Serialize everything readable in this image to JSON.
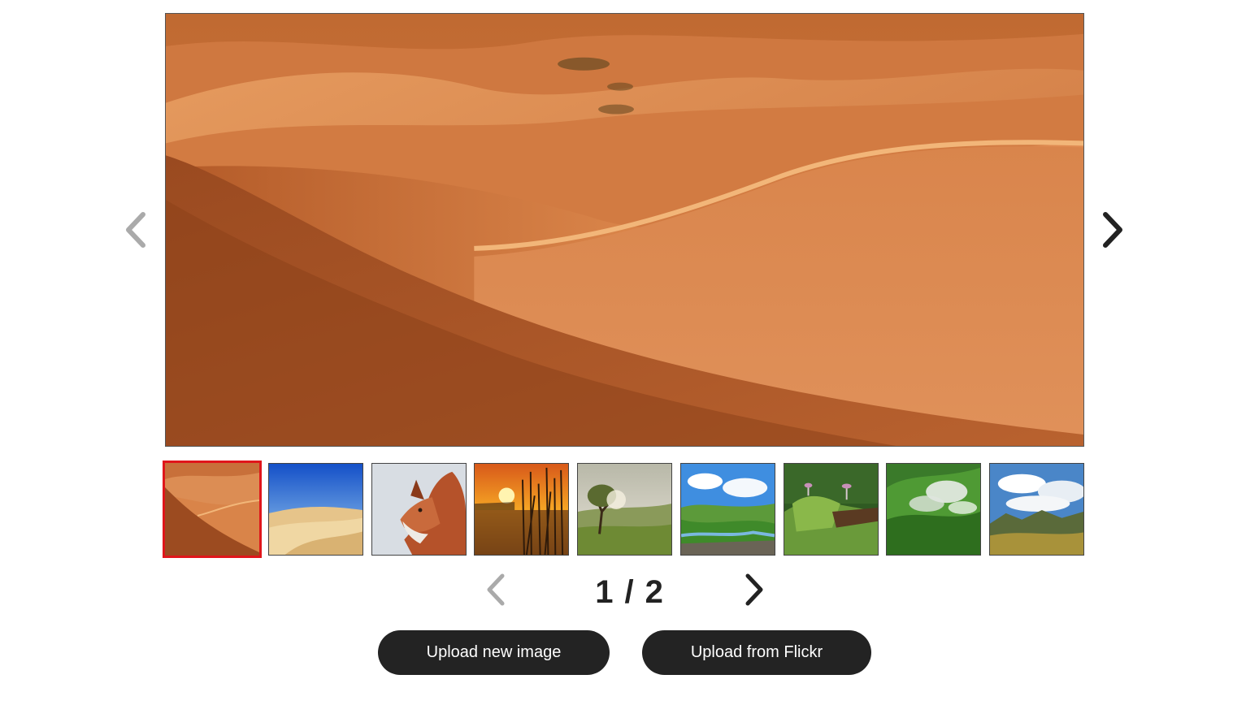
{
  "gallery": {
    "main_image": {
      "icon": "desert-dunes-image"
    },
    "prev_arrow": {
      "icon": "chevron-left-icon",
      "color": "#aaaaaa"
    },
    "next_arrow": {
      "icon": "chevron-right-icon",
      "color": "#222222"
    },
    "thumbnails": [
      {
        "icon": "desert-dunes-thumbnail",
        "active": true
      },
      {
        "icon": "sand-dunes-blue-sky-thumbnail",
        "active": false
      },
      {
        "icon": "fox-thumbnail",
        "active": false
      },
      {
        "icon": "sunset-reeds-thumbnail",
        "active": false
      },
      {
        "icon": "tree-landscape-thumbnail",
        "active": false
      },
      {
        "icon": "green-valley-thumbnail",
        "active": false
      },
      {
        "icon": "moss-mushrooms-thumbnail",
        "active": false
      },
      {
        "icon": "misty-green-hills-thumbnail",
        "active": false
      },
      {
        "icon": "mountain-clouds-thumbnail",
        "active": false
      }
    ],
    "active_color": "#e0161b"
  },
  "pagination": {
    "current": "1",
    "separator": "/",
    "total": "2",
    "prev_icon": "chevron-left-icon",
    "next_icon": "chevron-right-icon"
  },
  "buttons": {
    "upload_new_label": "Upload new image",
    "upload_flickr_label": "Upload from Flickr",
    "background": "#232323"
  }
}
